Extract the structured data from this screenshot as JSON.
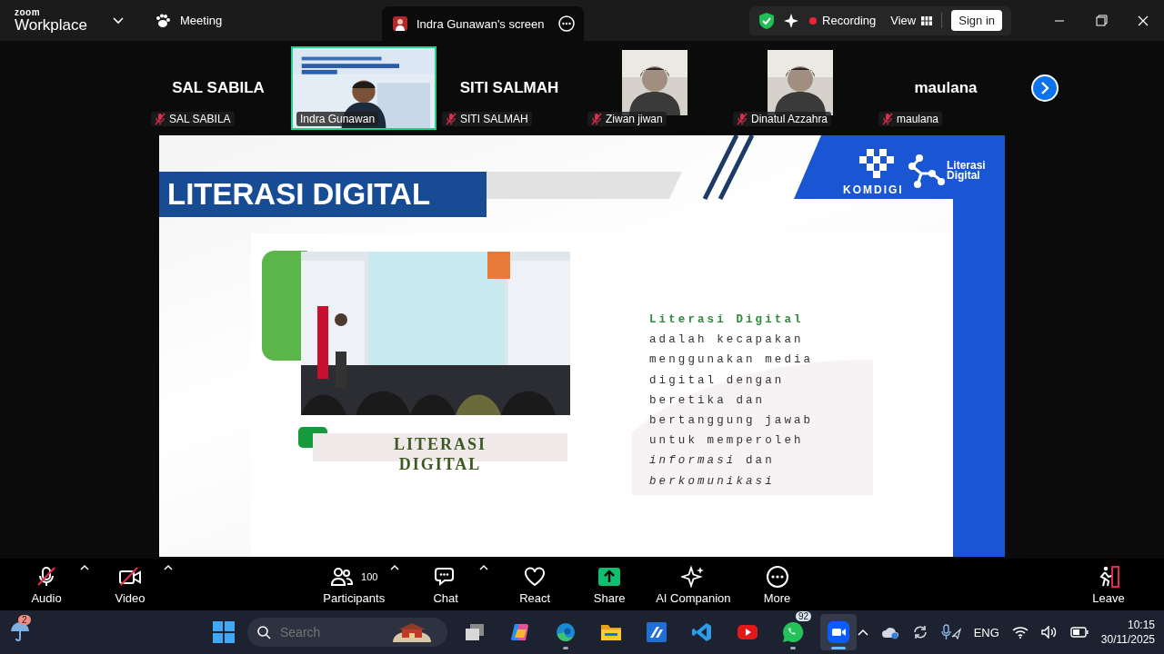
{
  "title_bar": {
    "logo_top": "zoom",
    "logo_bottom": "Workplace",
    "meeting_label": "Meeting",
    "share_tab": "Indra Gunawan's screen",
    "recording": "Recording",
    "view": "View",
    "sign_in": "Sign in"
  },
  "participants": [
    {
      "kind": "name",
      "display": "SAL SABILA",
      "name": "SAL SABILA",
      "muted": true,
      "speaking": false
    },
    {
      "kind": "video",
      "name": "Indra Gunawan",
      "muted": false,
      "speaking": true
    },
    {
      "kind": "name",
      "display": "SITI SALMAH",
      "name": "SITI SALMAH",
      "muted": true,
      "speaking": false
    },
    {
      "kind": "avatar",
      "name": "Ziwan jiwan",
      "muted": true,
      "speaking": false
    },
    {
      "kind": "avatar",
      "name": "Dinatul Azzahra",
      "muted": true,
      "speaking": false
    },
    {
      "kind": "name",
      "display": "maulana",
      "name": "maulana",
      "muted": true,
      "speaking": false
    }
  ],
  "slide": {
    "heading": "LITERASI DIGITAL",
    "brand": "KOMDIGI",
    "logo_text": "Literasi Digital",
    "caption": "LITERASI DIGITAL",
    "paragraph": "**Literasi Digital** adalah kecapakan menggunakan media digital dengan beretika dan bertanggung jawab untuk memperoleh *informasi* dan *berkomunikasi*"
  },
  "toolbar": [
    {
      "kind": "audio",
      "label": "Audio",
      "off": true,
      "caret": true
    },
    {
      "kind": "video",
      "label": "Video",
      "off": true,
      "caret": true
    },
    {
      "kind": "participants",
      "label": "Participants",
      "count": "100",
      "caret": true
    },
    {
      "kind": "chat",
      "label": "Chat",
      "caret": true
    },
    {
      "kind": "react",
      "label": "React",
      "caret": false
    },
    {
      "kind": "share",
      "label": "Share",
      "caret": false
    },
    {
      "kind": "ai",
      "label": "AI Companion",
      "caret": false
    },
    {
      "kind": "more",
      "label": "More",
      "caret": false
    },
    {
      "kind": "leave",
      "label": "Leave",
      "caret": false
    }
  ],
  "taskbar": {
    "weather_badge": "2",
    "search": {
      "placeholder": "Search"
    },
    "apps": [
      {
        "kind": "taskview",
        "running": false,
        "active": false
      },
      {
        "kind": "copilot",
        "running": false,
        "active": false
      },
      {
        "kind": "edge",
        "running": true,
        "active": false
      },
      {
        "kind": "explorer",
        "running": false,
        "active": false
      },
      {
        "kind": "azure",
        "running": false,
        "active": false
      },
      {
        "kind": "vscode",
        "running": false,
        "active": false
      },
      {
        "kind": "youtube",
        "running": false,
        "active": false
      },
      {
        "kind": "whatsapp",
        "running": true,
        "active": false,
        "badge": "92"
      },
      {
        "kind": "zoom",
        "running": true,
        "active": true
      }
    ],
    "language": "ENG",
    "time": "10:15",
    "date": "30/11/2025"
  }
}
